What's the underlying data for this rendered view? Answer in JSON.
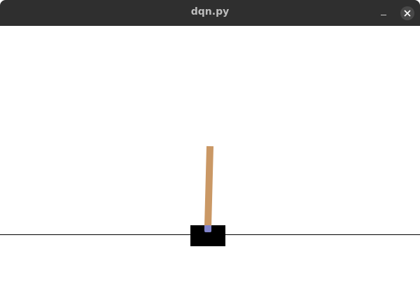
{
  "window": {
    "title": "dqn.py",
    "controls": [
      "minimize-icon",
      "close-icon"
    ]
  },
  "scene": {
    "environment": "CartPole",
    "colors": {
      "background": "#ffffff",
      "track": "#000000",
      "cart": "#000000",
      "pole": "#ca9865",
      "axle": "#8184cb",
      "titlebar": "#2f2f2f"
    }
  }
}
